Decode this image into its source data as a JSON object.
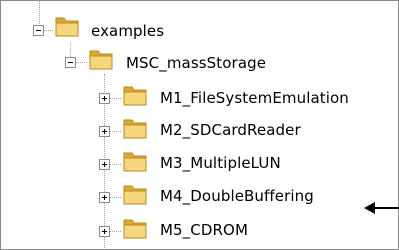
{
  "tree": {
    "root": {
      "label": "examples",
      "expanded": true,
      "icon": "folder-icon"
    },
    "child": {
      "label": "MSC_massStorage",
      "expanded": true,
      "icon": "folder-icon"
    },
    "items": [
      {
        "label": "M1_FileSystemEmulation",
        "expanded": false,
        "icon": "folder-icon"
      },
      {
        "label": "M2_SDCardReader",
        "expanded": false,
        "icon": "folder-icon"
      },
      {
        "label": "M3_MultipleLUN",
        "expanded": false,
        "icon": "folder-icon"
      },
      {
        "label": "M4_DoubleBuffering",
        "expanded": false,
        "icon": "folder-icon"
      },
      {
        "label": "M5_CDROM",
        "expanded": false,
        "icon": "folder-icon"
      }
    ]
  },
  "annotation": {
    "icon": "arrow-left-icon",
    "target": "M4_DoubleBuffering",
    "color": "#000000"
  },
  "colors": {
    "folder_light": "#f6d77d",
    "folder_dark": "#d9a935",
    "folder_edge": "#b98a22",
    "guide": "#a0a0a0"
  }
}
